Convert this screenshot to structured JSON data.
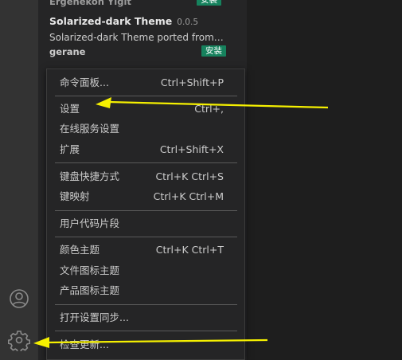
{
  "extensions": [
    {
      "author": "Ergenekon Yigit",
      "install_label": "安装"
    },
    {
      "name": "Solarized-dark Theme",
      "version": "0.0.5",
      "description": "Solarized-dark Theme ported from t...",
      "author": "gerane",
      "install_label": "安装"
    }
  ],
  "menu": {
    "items": [
      {
        "label": "命令面板...",
        "shortcut": "Ctrl+Shift+P"
      },
      {
        "label": "设置",
        "shortcut": "Ctrl+,"
      },
      {
        "label": "在线服务设置",
        "shortcut": ""
      },
      {
        "label": "扩展",
        "shortcut": "Ctrl+Shift+X"
      },
      {
        "label": "键盘快捷方式",
        "shortcut": "Ctrl+K Ctrl+S"
      },
      {
        "label": "键映射",
        "shortcut": "Ctrl+K Ctrl+M"
      },
      {
        "label": "用户代码片段",
        "shortcut": ""
      },
      {
        "label": "颜色主题",
        "shortcut": "Ctrl+K Ctrl+T"
      },
      {
        "label": "文件图标主题",
        "shortcut": ""
      },
      {
        "label": "产品图标主题",
        "shortcut": ""
      },
      {
        "label": "打开设置同步...",
        "shortcut": ""
      },
      {
        "label": "检查更新...",
        "shortcut": ""
      }
    ]
  },
  "activity_bar": {
    "icons": [
      "account-icon",
      "gear-icon"
    ]
  },
  "colors": {
    "install_badge": "#16825d",
    "annotation_arrow": "#f5f000",
    "menu_background": "#252526"
  }
}
